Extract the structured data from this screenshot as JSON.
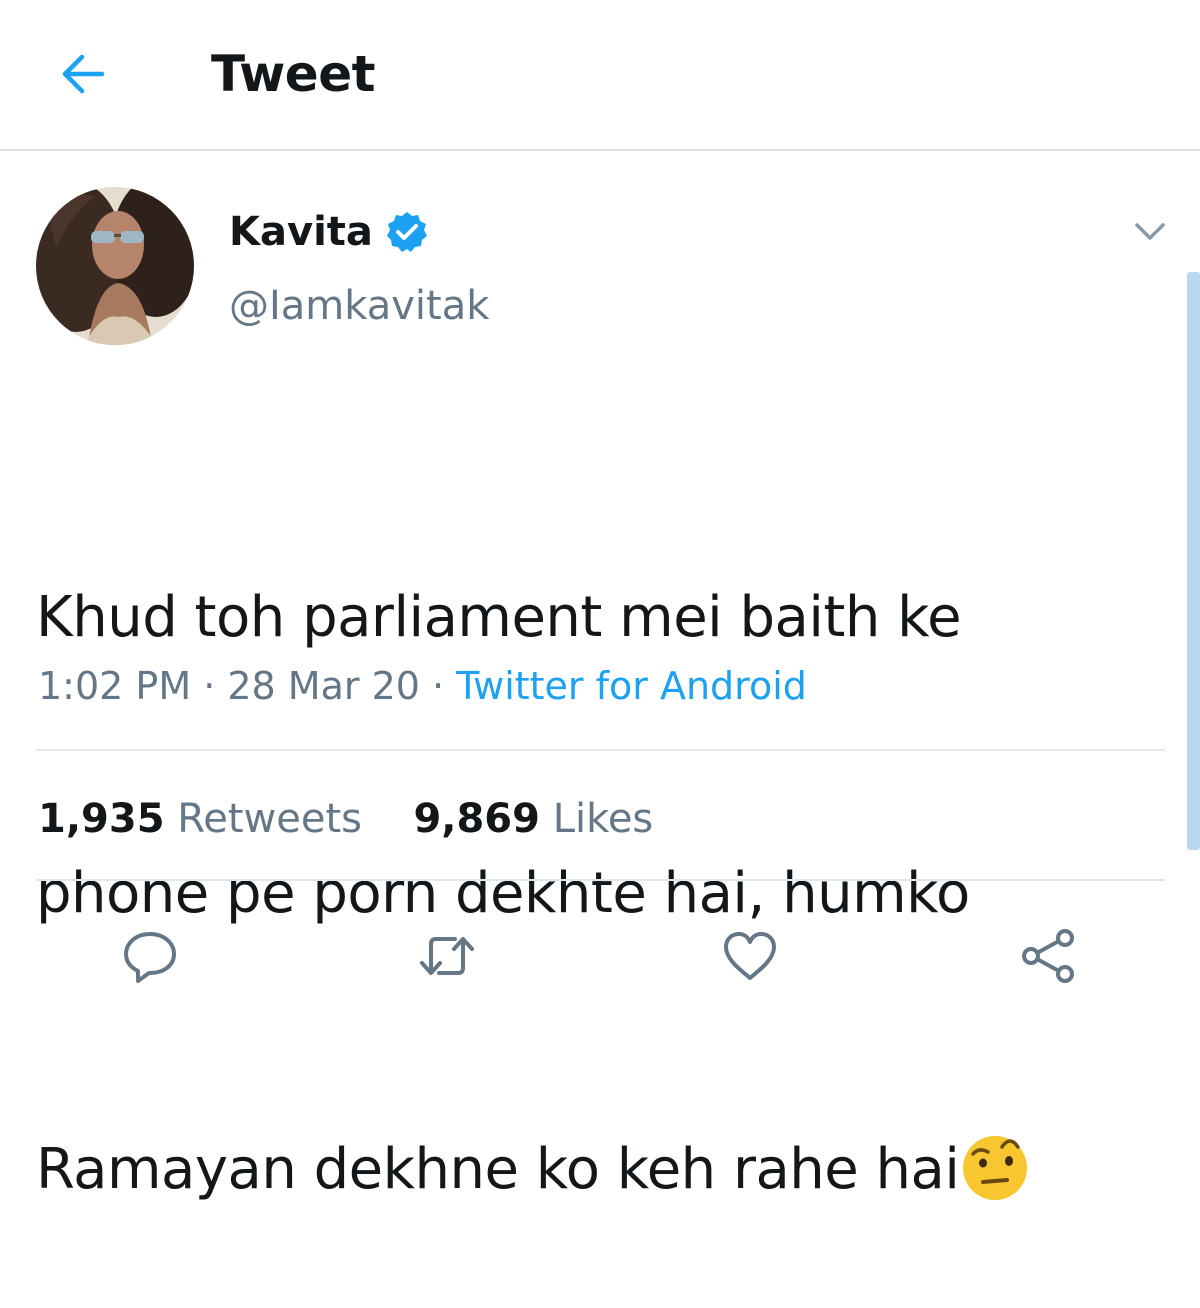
{
  "header": {
    "back_icon": "arrow-left-icon",
    "title": "Tweet"
  },
  "tweet": {
    "author": {
      "name": "Kavita",
      "handle": "@Iamkavitak",
      "verified": true,
      "avatar_icon": "profile-photo"
    },
    "text_lines": [
      "Khud toh parliament mei baith ke",
      "phone pe porn dekhte hai, humko",
      "Ramayan dekhne ko keh rahe hai"
    ],
    "emoji": "face-with-raised-eyebrow",
    "time": "1:02 PM",
    "separator": " · ",
    "date": "28 Mar 20",
    "source": "Twitter for Android",
    "stats": {
      "retweets_count": "1,935",
      "retweets_label": "Retweets",
      "likes_count": "9,869",
      "likes_label": "Likes"
    }
  },
  "actions": [
    "reply-icon",
    "retweet-icon",
    "like-icon",
    "share-icon"
  ],
  "colors": {
    "accent": "#1da1f2",
    "text_primary": "#14171a",
    "text_secondary": "#657786",
    "divider": "#e1e8ed",
    "verified_badge": "#1da1f2"
  }
}
